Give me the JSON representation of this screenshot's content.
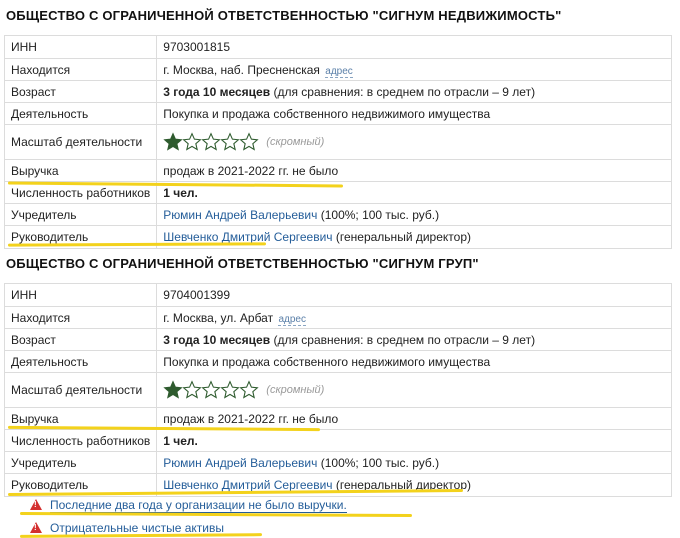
{
  "companies": [
    {
      "title": "ОБЩЕСТВО С ОГРАНИЧЕННОЙ ОТВЕТСТВЕННОСТЬЮ \"СИГНУМ НЕДВИЖИМОСТЬ\"",
      "labels": {
        "inn": "ИНН",
        "location": "Находится",
        "age": "Возраст",
        "activity": "Деятельность",
        "scale": "Масштаб деятельности",
        "revenue": "Выручка",
        "employees": "Численность работников",
        "founder": "Учредитель",
        "director": "Руководитель"
      },
      "inn": "9703001815",
      "location": "г. Москва, наб. Пресненская",
      "address_link": "адрес",
      "age_value": "3 года 10 месяцев",
      "age_compare": "(для сравнения: в среднем по отрасли – 9 лет)",
      "activity": "Покупка и продажа собственного недвижимого имущества",
      "scale_rating": 1,
      "scale_max": 5,
      "scale_note": "(скромный)",
      "revenue": "продаж в 2021-2022 гг. не было",
      "employees": "1 чел.",
      "founder_name": "Рюмин Андрей Валерьевич",
      "founder_share": "(100%; 100 тыс. руб.)",
      "director_name": "Шевченко Дмитрий Сергеевич",
      "director_role": "(генеральный директор)"
    },
    {
      "title": "ОБЩЕСТВО С ОГРАНИЧЕННОЙ ОТВЕТСТВЕННОСТЬЮ \"СИГНУМ ГРУП\"",
      "labels": {
        "inn": "ИНН",
        "location": "Находится",
        "age": "Возраст",
        "activity": "Деятельность",
        "scale": "Масштаб деятельности",
        "revenue": "Выручка",
        "employees": "Численность работников",
        "founder": "Учредитель",
        "director": "Руководитель"
      },
      "inn": "9704001399",
      "location": "г. Москва, ул. Арбат",
      "address_link": "адрес",
      "age_value": "3 года 10 месяцев",
      "age_compare": "(для сравнения: в среднем по отрасли – 9 лет)",
      "activity": "Покупка и продажа собственного недвижимого имущества",
      "scale_rating": 1,
      "scale_max": 5,
      "scale_note": "(скромный)",
      "revenue": "продаж в 2021-2022 гг. не было",
      "employees": "1 чел.",
      "founder_name": "Рюмин Андрей Валерьевич",
      "founder_share": "(100%; 100 тыс. руб.)",
      "director_name": "Шевченко Дмитрий Сергеевич",
      "director_role": "(генеральный директор)"
    }
  ],
  "warnings": [
    "Последние два года у организации не было выручки.",
    "Отрицательные чистые активы"
  ],
  "colors": {
    "link": "#245d99",
    "star_fill": "#2e5b2e",
    "highlight": "#f3d21c",
    "warning": "#d42f2f"
  }
}
